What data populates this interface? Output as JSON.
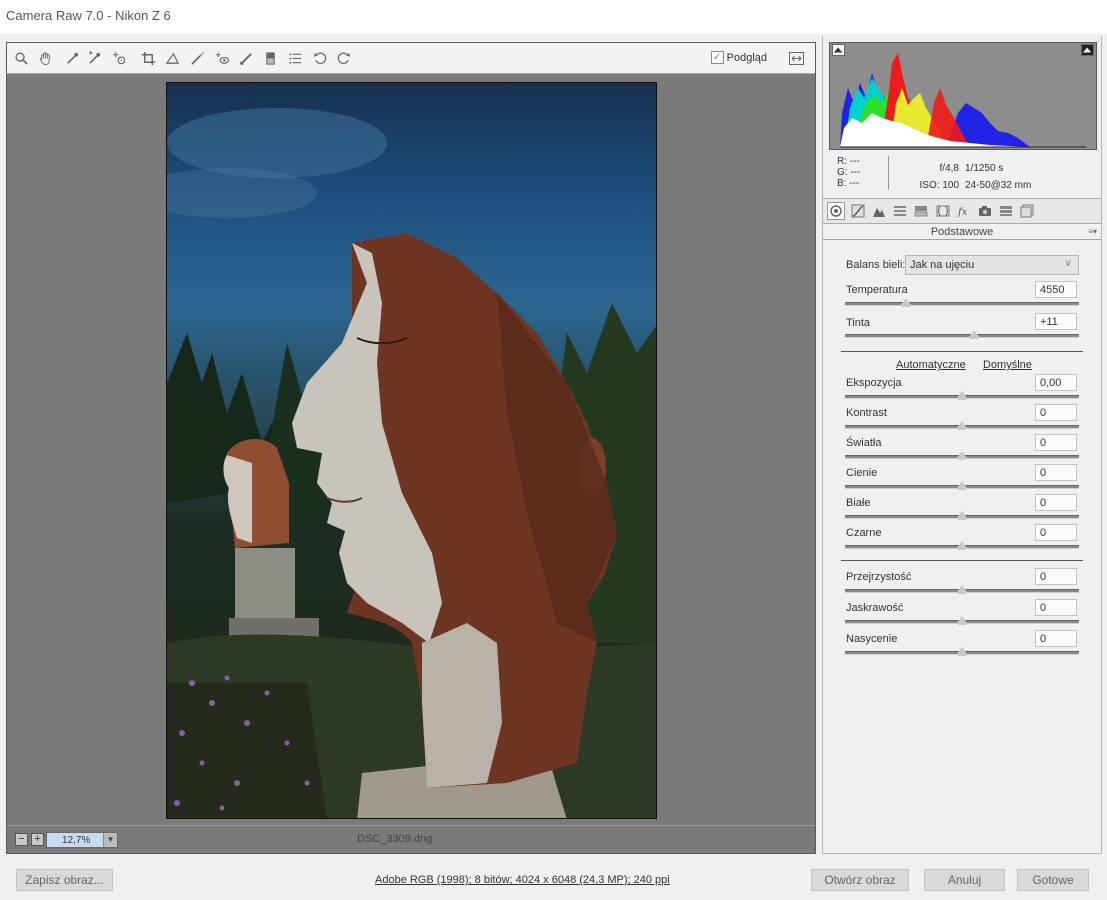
{
  "window": {
    "title": "Camera Raw 7.0  -  Nikon Z 6"
  },
  "toolbar": {
    "tools": [
      "zoom-icon",
      "hand-icon",
      "white-balance-eyedropper-icon",
      "color-sampler-icon",
      "targeted-adjustment-icon",
      "crop-icon",
      "straighten-icon",
      "spot-removal-icon",
      "red-eye-icon",
      "adjustment-brush-icon",
      "graduated-filter-icon",
      "presets-icon",
      "rotate-left-icon",
      "rotate-right-icon"
    ],
    "preview_label": "Podgląd",
    "preview_checked": true
  },
  "statusbar": {
    "zoom": "12,7%",
    "filename": "DSC_3309.dng"
  },
  "readout": {
    "r": "R:  ---",
    "g": "G:  ---",
    "b": "B:  ---",
    "aperture": "f/4,8",
    "shutter": "1/1250 s",
    "iso": "ISO: 100",
    "lens": "24-50@32 mm"
  },
  "panel": {
    "title": "Podstawowe",
    "white_balance_label": "Balans bieli:",
    "white_balance_value": "Jak na ujęciu",
    "temperature": {
      "label": "Temperatura",
      "value": "4550",
      "position": 0.26
    },
    "tint": {
      "label": "Tinta",
      "value": "+11",
      "position": 0.55
    },
    "auto_label": "Automatyczne",
    "default_label": "Domyślne",
    "tone": [
      {
        "label": "Ekspozycja",
        "value": "0,00",
        "position": 0.5
      },
      {
        "label": "Kontrast",
        "value": "0",
        "position": 0.5
      },
      {
        "label": "Światła",
        "value": "0",
        "position": 0.5
      },
      {
        "label": "Cienie",
        "value": "0",
        "position": 0.5
      },
      {
        "label": "Białe",
        "value": "0",
        "position": 0.5
      },
      {
        "label": "Czarne",
        "value": "0",
        "position": 0.5
      }
    ],
    "presence": [
      {
        "label": "Przejrzystość",
        "value": "0",
        "position": 0.5
      },
      {
        "label": "Jaskrawość",
        "value": "0",
        "position": 0.5
      },
      {
        "label": "Nasycenie",
        "value": "0",
        "position": 0.5
      }
    ]
  },
  "footer": {
    "save": "Zapisz obraz...",
    "workflow": "Adobe RGB (1998); 8 bitów; 4024 x 6048 (24,3 MP); 240 ppi",
    "open": "Otwórz obraz",
    "cancel": "Anuluj",
    "done": "Gotowe"
  }
}
